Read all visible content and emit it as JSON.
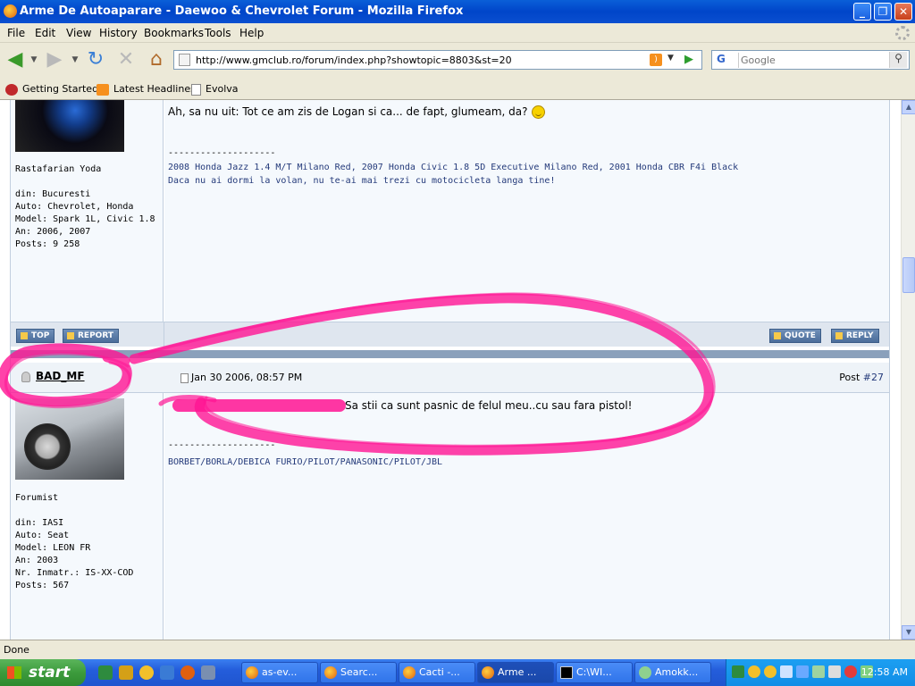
{
  "window": {
    "title": "Arme De Autoaparare - Daewoo & Chevrolet Forum - Mozilla Firefox"
  },
  "menu": [
    "File",
    "Edit",
    "View",
    "History",
    "Bookmarks",
    "Tools",
    "Help"
  ],
  "address": {
    "url": "http://www.gmclub.ro/forum/index.php?showtopic=8803&st=20"
  },
  "search": {
    "placeholder": "Google",
    "engine": "G"
  },
  "bookmarks": [
    "Getting Started",
    "Latest Headlines",
    "Evolva"
  ],
  "post1": {
    "title": "Rastafarian Yoda",
    "info": [
      "din: Bucuresti",
      "Auto: Chevrolet, Honda",
      "Model: Spark 1L, Civic 1.8",
      "An: 2006, 2007",
      "Posts: 9 258"
    ],
    "text": "Ah, sa nu uit: Tot ce am zis de Logan si ca... de fapt, glumeam, da?",
    "separator": "--------------------",
    "sig_lines": [
      "2008 Honda Jazz 1.4 M/T Milano Red, 2007 Honda Civic 1.8 5D Executive Milano Red, 2001 Honda CBR F4i Black",
      "Daca nu ai dormi la volan, nu te-ai mai trezi cu motocicleta langa tine!"
    ]
  },
  "buttons": {
    "top": "TOP",
    "report": "REPORT",
    "quote": "QUOTE",
    "reply": "REPLY"
  },
  "post2": {
    "username": "BAD_MF",
    "date": "Jan 30 2006, 08:57 PM",
    "post_label": "Post",
    "post_num": "#27",
    "title": "Forumist",
    "info": [
      "din: IASI",
      "Auto: Seat",
      "Model: LEON FR",
      "An: 2003",
      "Nr. Inmatr.: IS-XX-COD",
      "Posts: 567"
    ],
    "text": "Sa stii ca sunt pasnic de felul meu..cu sau fara pistol!",
    "separator": "--------------------",
    "sig": "BORBET/BORLA/DEBICA FURIO/PILOT/PANASONIC/PILOT/JBL"
  },
  "status": {
    "text": "Done"
  },
  "taskbar": {
    "start": "start",
    "tasks": [
      "as-ev...",
      "Searc...",
      "Cacti -...",
      "Arme ...",
      "C:\\WI...",
      "Amokk..."
    ],
    "clock": "12:58 AM"
  },
  "colors": {
    "annotation": "#ff1493",
    "accent": "#243a7a"
  }
}
